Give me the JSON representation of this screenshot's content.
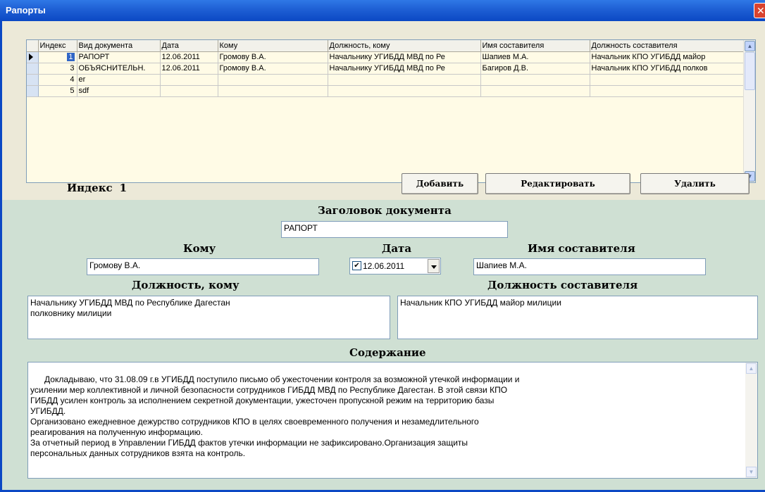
{
  "window": {
    "title": "Рапорты"
  },
  "grid": {
    "headers": [
      "Индекс",
      "Вид документа",
      "Дата",
      "Кому",
      "Должность, кому",
      "Имя составителя",
      "Должность составителя"
    ],
    "rows": [
      {
        "idx": "1",
        "type": "РАПОРТ",
        "date": "12.06.2011",
        "to": "Громову В.А.",
        "to_pos": "Начальнику УГИБДД МВД по Ре",
        "author": "Шапиев М.А.",
        "author_pos": "Начальник КПО УГИБДД майор"
      },
      {
        "idx": "3",
        "type": "ОБЪЯСНИТЕЛЬН.",
        "date": "12.06.2011",
        "to": "Громову В.А.",
        "to_pos": "Начальнику УГИБДД МВД по Ре",
        "author": "Багиров Д.В.",
        "author_pos": "Начальник КПО УГИБДД полков"
      },
      {
        "idx": "4",
        "type": "er",
        "date": "",
        "to": "",
        "to_pos": "",
        "author": "",
        "author_pos": ""
      },
      {
        "idx": "5",
        "type": "sdf",
        "date": "",
        "to": "",
        "to_pos": "",
        "author": "",
        "author_pos": ""
      }
    ]
  },
  "toolbar": {
    "index_label": "Индекс",
    "index_value": "1",
    "add_label": "Добавить",
    "edit_label": "Редактировать",
    "delete_label": "Удалить"
  },
  "form": {
    "title_label": "Заголовок документа",
    "title_value": "РАПОРТ",
    "to_label": "Кому",
    "to_value": "Громову В.А.",
    "date_label": "Дата",
    "date_value": "12.06.2011",
    "author_label": "Имя составителя",
    "author_value": "Шапиев М.А.",
    "to_pos_label": "Должность, кому",
    "to_pos_value": "Начальнику УГИБДД МВД по Республике Дагестан\nполковнику милиции",
    "author_pos_label": "Должность составителя",
    "author_pos_value": "Начальник КПО УГИБДД майор милиции",
    "content_label": "Содержание",
    "content_value": "Докладываю, что 31.08.09 г.в УГИБДД поступило письмо об ужесточении контроля за возможной утечкой информации и\nусилении мер коллективной и личной безопасности сотрудников ГИБДД МВД по Республике Дагестан. В этой связи КПО\nГИБДД усилен контроль за исполнением секретной документации, ужесточен пропускной режим на территорию базы\nУГИБДД.\nОрганизовано ежедневное дежурство сотрудников КПО в целях своевременного получения и незамедлительного\nреагирования на полученную информацию.\nЗа отчетный период в Управлении ГИБДД фактов утечки информации не зафиксировано.Организация защиты\nперсональных данных сотрудников взята на контроль."
  }
}
